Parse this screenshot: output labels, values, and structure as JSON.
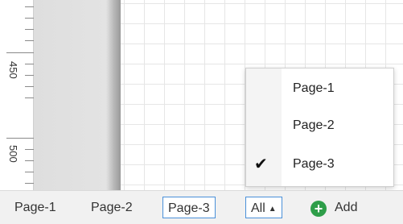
{
  "ruler": {
    "labels": [
      "450",
      "500"
    ]
  },
  "tabs": [
    {
      "label": "Page-1",
      "active": false
    },
    {
      "label": "Page-2",
      "active": false
    },
    {
      "label": "Page-3",
      "active": true
    }
  ],
  "all_button": {
    "label": "All",
    "icon": "caret-up-icon"
  },
  "add_button": {
    "label": "Add",
    "icon": "plus-circle-icon",
    "color": "#2e9e49"
  },
  "menu": {
    "items": [
      {
        "label": "Page-1",
        "checked": false
      },
      {
        "label": "Page-2",
        "checked": false
      },
      {
        "label": "Page-3",
        "checked": true
      }
    ],
    "check_glyph": "✔"
  },
  "colors": {
    "accent": "#4a90d9",
    "add": "#2e9e49"
  }
}
